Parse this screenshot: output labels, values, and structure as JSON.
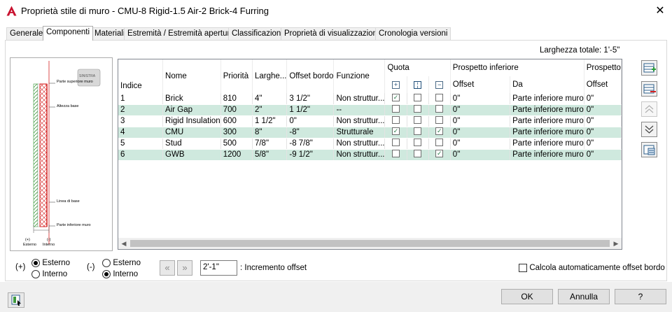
{
  "window": {
    "title": "Proprietà stile di muro - CMU-8 Rigid-1.5 Air-2 Brick-4 Furring",
    "app_icon": "autocad-a-icon",
    "close_label": "✕"
  },
  "tabs": [
    {
      "label": "Generale"
    },
    {
      "label": "Componenti"
    },
    {
      "label": "Materiali"
    },
    {
      "label": "Estremità / Estremità apertura"
    },
    {
      "label": "Classificazioni"
    },
    {
      "label": "Proprietà di visualizzazione"
    },
    {
      "label": "Cronologia versioni"
    }
  ],
  "total_width": "Larghezza totale: 1'-5\"",
  "preview": {
    "labels": {
      "top": "Parte superiore muro",
      "height": "Altezza base",
      "baseline": "Linea di base",
      "bottom": "Parte inferiore muro",
      "ext_sign": "(+)",
      "ext": "Esterno",
      "int_sign": "(-)",
      "int": "Interno",
      "stamp": "SINISTRA"
    }
  },
  "grid": {
    "headers": {
      "index": "Indice",
      "name": "Nome",
      "priority": "Priorità",
      "width": "Larghe...",
      "offset": "Offset bordo",
      "function": "Funzione",
      "dimension": "Quota",
      "bottom_elev": "Prospetto inferiore",
      "offset_sub": "Offset",
      "from_sub": "Da",
      "top_elev": "Prospetto",
      "offset_sub2": "Offset"
    },
    "rows": [
      {
        "index": "1",
        "name": "Brick",
        "priority": "810",
        "width": "4\"",
        "offset": "3 1/2\"",
        "function": "Non struttur...",
        "d1": true,
        "d2": false,
        "d3": false,
        "b_offset": "0\"",
        "b_from": "Parte inferiore muro",
        "t_offset": "0\""
      },
      {
        "index": "2",
        "name": "Air Gap",
        "priority": "700",
        "width": "2\"",
        "offset": "1 1/2\"",
        "function": "--",
        "d1": false,
        "d2": false,
        "d3": false,
        "b_offset": "0\"",
        "b_from": "Parte inferiore muro",
        "t_offset": "0\""
      },
      {
        "index": "3",
        "name": "Rigid Insulation",
        "priority": "600",
        "width": "1 1/2\"",
        "offset": "0\"",
        "function": "Non struttur...",
        "d1": false,
        "d2": false,
        "d3": false,
        "b_offset": "0\"",
        "b_from": "Parte inferiore muro",
        "t_offset": "0\""
      },
      {
        "index": "4",
        "name": "CMU",
        "priority": "300",
        "width": "8\"",
        "offset": "-8\"",
        "function": "Strutturale",
        "d1": true,
        "d2": false,
        "d3": true,
        "b_offset": "0\"",
        "b_from": "Parte inferiore muro",
        "t_offset": "0\""
      },
      {
        "index": "5",
        "name": "Stud",
        "priority": "500",
        "width": "7/8\"",
        "offset": "-8 7/8\"",
        "function": "Non struttur...",
        "d1": false,
        "d2": false,
        "d3": false,
        "b_offset": "0\"",
        "b_from": "Parte inferiore muro",
        "t_offset": "0\""
      },
      {
        "index": "6",
        "name": "GWB",
        "priority": "1200",
        "width": "5/8\"",
        "offset": "-9 1/2\"",
        "function": "Non struttur...",
        "d1": false,
        "d2": false,
        "d3": true,
        "b_offset": "0\"",
        "b_from": "Parte inferiore muro",
        "t_offset": "0\""
      }
    ]
  },
  "side_buttons": [
    "add-component-icon",
    "remove-component-icon",
    "move-up-icon",
    "move-down-icon",
    "component-list-icon"
  ],
  "left_radio": {
    "sign": "(+)",
    "opt1": "Esterno",
    "opt2": "Interno",
    "selected": "Esterno"
  },
  "right_radio": {
    "sign": "(-)",
    "opt1": "Esterno",
    "opt2": "Interno",
    "selected": "Interno"
  },
  "offset_increment": {
    "value": "2'-1\"",
    "label": ": Incremento offset"
  },
  "auto_offset": {
    "label": "Calcola automaticamente offset bordo",
    "checked": false
  },
  "buttons": {
    "ok": "OK",
    "cancel": "Annulla",
    "help": "?"
  }
}
